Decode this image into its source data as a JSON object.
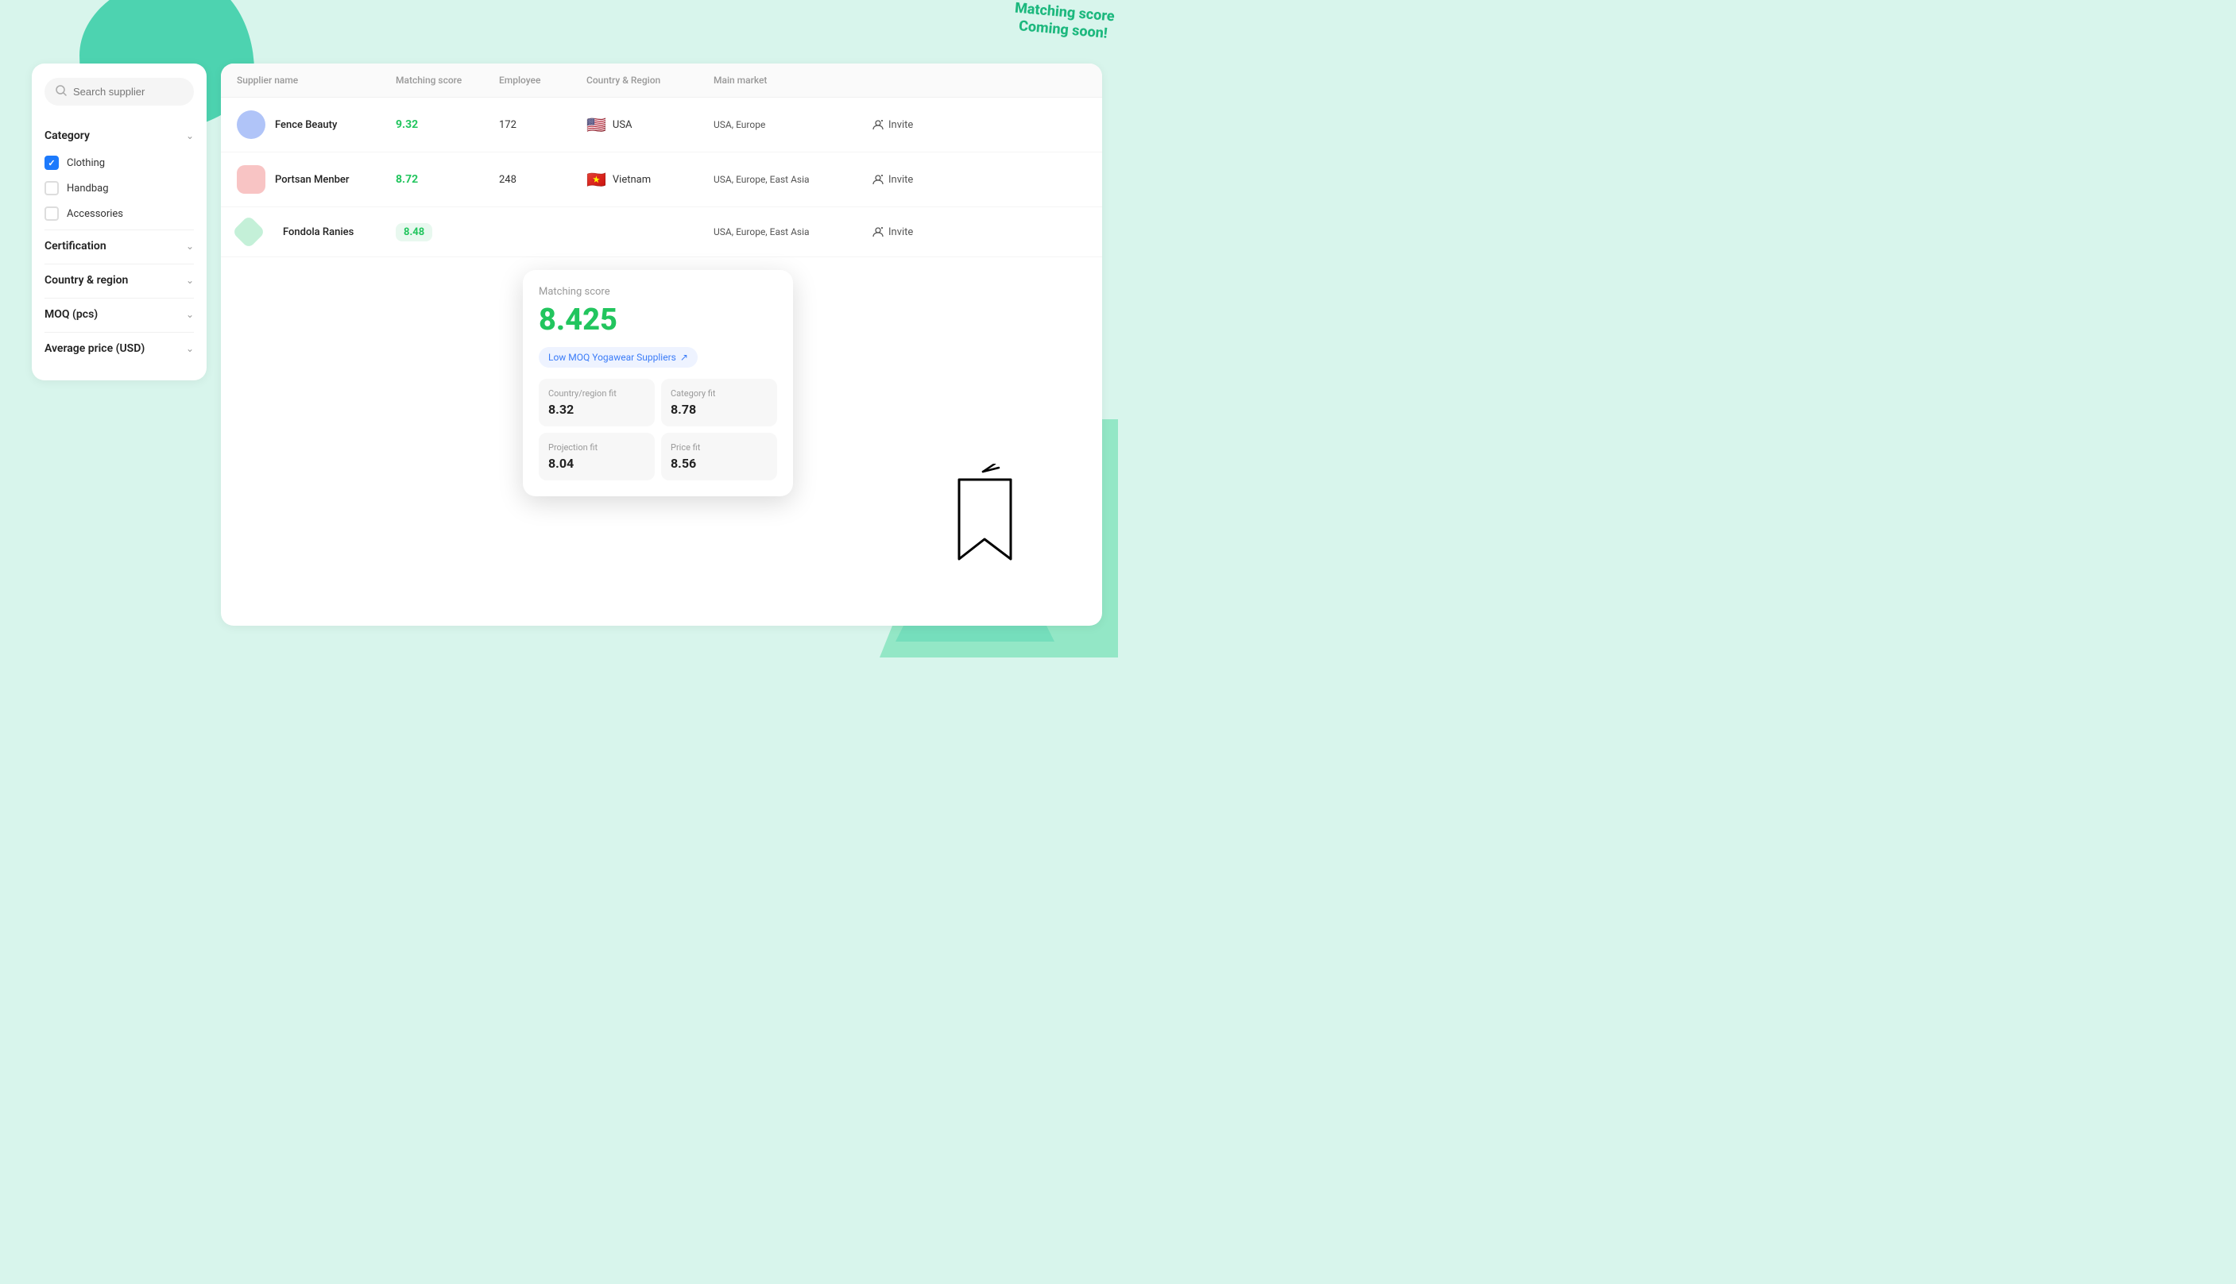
{
  "matching_badge": {
    "line1": "Matching score",
    "line2": "Coming soon!"
  },
  "sidebar": {
    "search_placeholder": "Search supplier",
    "filters": [
      {
        "id": "category",
        "label": "Category",
        "expanded": true,
        "options": [
          {
            "id": "clothing",
            "label": "Clothing",
            "checked": true
          },
          {
            "id": "handbag",
            "label": "Handbag",
            "checked": false
          },
          {
            "id": "accessories",
            "label": "Accessories",
            "checked": false
          }
        ]
      },
      {
        "id": "certification",
        "label": "Certification",
        "expanded": false
      },
      {
        "id": "country-region",
        "label": "Country & region",
        "expanded": false
      },
      {
        "id": "moq",
        "label": "MOQ (pcs)",
        "expanded": false
      },
      {
        "id": "avg-price",
        "label": "Average price (USD)",
        "expanded": false
      }
    ]
  },
  "table": {
    "columns": [
      "Supplier name",
      "Matching score",
      "Employee",
      "Country & Region",
      "Main market",
      ""
    ],
    "rows": [
      {
        "name": "Fence Beauty",
        "avatar_color": "#b0c4f8",
        "score": "9.32",
        "employees": "172",
        "country_flag": "🇺🇸",
        "country": "USA",
        "main_market": "USA, Europe",
        "invite_label": "Invite"
      },
      {
        "name": "Portsan Menber",
        "avatar_color": "#f8c4c4",
        "score": "8.72",
        "employees": "248",
        "country_flag": "🇻🇳",
        "country": "Vietnam",
        "main_market": "USA, Europe, East Asia",
        "invite_label": "Invite"
      },
      {
        "name": "Fondola Ranies",
        "avatar_color": "#c4f0d8",
        "score": "8.48",
        "employees": "",
        "country_flag": "",
        "country": "",
        "main_market": "USA, Europe, East Asia",
        "invite_label": "Invite"
      }
    ]
  },
  "tooltip": {
    "title": "Matching score",
    "score": "8.425",
    "link_label": "Low MOQ Yogawear Suppliers",
    "link_icon": "↗",
    "cards": [
      {
        "label": "Country/region fit",
        "value": "8.32"
      },
      {
        "label": "Category fit",
        "value": "8.78"
      },
      {
        "label": "Projection fit",
        "value": "8.04"
      },
      {
        "label": "Price fit",
        "value": "8.56"
      }
    ]
  }
}
